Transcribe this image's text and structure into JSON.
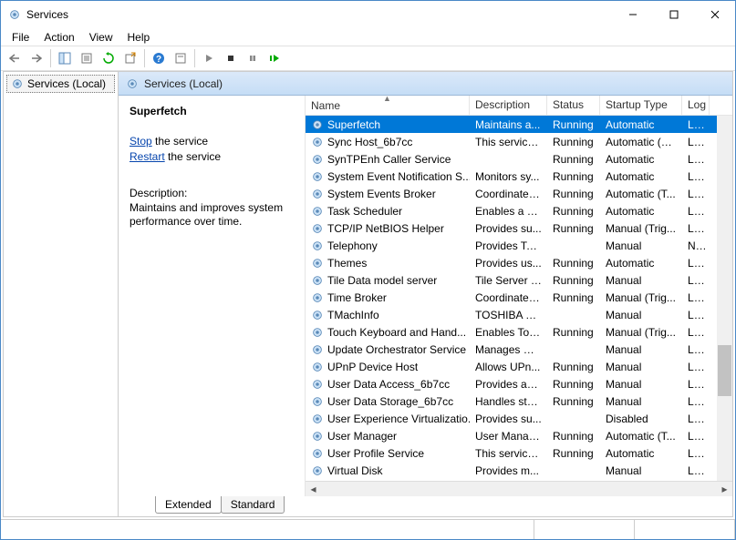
{
  "window_title": "Services",
  "menus": [
    "File",
    "Action",
    "View",
    "Help"
  ],
  "tree_node": "Services (Local)",
  "pane_header": "Services (Local)",
  "tabs": {
    "extended": "Extended",
    "standard": "Standard"
  },
  "detail": {
    "selected_name": "Superfetch",
    "stop_link": "Stop",
    "stop_suffix": " the service",
    "restart_link": "Restart",
    "restart_suffix": " the service",
    "desc_label": "Description:",
    "desc_text": "Maintains and improves system performance over time."
  },
  "columns": {
    "name": "Name",
    "description": "Description",
    "status": "Status",
    "startup": "Startup Type",
    "logon": "Log"
  },
  "services": [
    {
      "name": "Superfetch",
      "desc": "Maintains a...",
      "status": "Running",
      "startup": "Automatic",
      "logon": "Loc",
      "selected": true
    },
    {
      "name": "Sync Host_6b7cc",
      "desc": "This service ...",
      "status": "Running",
      "startup": "Automatic (D...",
      "logon": "Loc"
    },
    {
      "name": "SynTPEnh Caller Service",
      "desc": "",
      "status": "Running",
      "startup": "Automatic",
      "logon": "Loc"
    },
    {
      "name": "System Event Notification S...",
      "desc": "Monitors sy...",
      "status": "Running",
      "startup": "Automatic",
      "logon": "Loc"
    },
    {
      "name": "System Events Broker",
      "desc": "Coordinates...",
      "status": "Running",
      "startup": "Automatic (T...",
      "logon": "Loc"
    },
    {
      "name": "Task Scheduler",
      "desc": "Enables a us...",
      "status": "Running",
      "startup": "Automatic",
      "logon": "Loc"
    },
    {
      "name": "TCP/IP NetBIOS Helper",
      "desc": "Provides su...",
      "status": "Running",
      "startup": "Manual (Trig...",
      "logon": "Loc"
    },
    {
      "name": "Telephony",
      "desc": "Provides Tel...",
      "status": "",
      "startup": "Manual",
      "logon": "Net"
    },
    {
      "name": "Themes",
      "desc": "Provides us...",
      "status": "Running",
      "startup": "Automatic",
      "logon": "Loc"
    },
    {
      "name": "Tile Data model server",
      "desc": "Tile Server f...",
      "status": "Running",
      "startup": "Manual",
      "logon": "Loc"
    },
    {
      "name": "Time Broker",
      "desc": "Coordinates...",
      "status": "Running",
      "startup": "Manual (Trig...",
      "logon": "Loc"
    },
    {
      "name": "TMachInfo",
      "desc": "TOSHIBA M...",
      "status": "",
      "startup": "Manual",
      "logon": "Loc"
    },
    {
      "name": "Touch Keyboard and Hand...",
      "desc": "Enables Tou...",
      "status": "Running",
      "startup": "Manual (Trig...",
      "logon": "Loc"
    },
    {
      "name": "Update Orchestrator Service",
      "desc": "Manages W...",
      "status": "",
      "startup": "Manual",
      "logon": "Loc"
    },
    {
      "name": "UPnP Device Host",
      "desc": "Allows UPn...",
      "status": "Running",
      "startup": "Manual",
      "logon": "Loc"
    },
    {
      "name": "User Data Access_6b7cc",
      "desc": "Provides ap...",
      "status": "Running",
      "startup": "Manual",
      "logon": "Loc"
    },
    {
      "name": "User Data Storage_6b7cc",
      "desc": "Handles sto...",
      "status": "Running",
      "startup": "Manual",
      "logon": "Loc"
    },
    {
      "name": "User Experience Virtualizatio...",
      "desc": "Provides su...",
      "status": "",
      "startup": "Disabled",
      "logon": "Loc"
    },
    {
      "name": "User Manager",
      "desc": "User Manag...",
      "status": "Running",
      "startup": "Automatic (T...",
      "logon": "Loc"
    },
    {
      "name": "User Profile Service",
      "desc": "This service ...",
      "status": "Running",
      "startup": "Automatic",
      "logon": "Loc"
    },
    {
      "name": "Virtual Disk",
      "desc": "Provides m...",
      "status": "",
      "startup": "Manual",
      "logon": "Loc"
    }
  ]
}
